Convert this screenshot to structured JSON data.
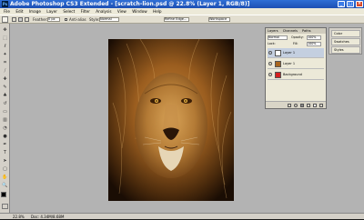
{
  "app": {
    "title": "Adobe Photoshop CS3 Extended - [scratch-lion.psd @ 22.8% (Layer 1, RGB/8)]",
    "icon_label": "Ps"
  },
  "menubar": {
    "items": [
      "File",
      "Edit",
      "Image",
      "Layer",
      "Select",
      "Filter",
      "Analysis",
      "View",
      "Window",
      "Help"
    ]
  },
  "options": {
    "feather_label": "Feather:",
    "feather_value": "0 px",
    "antialias_label": "Anti-alias",
    "style_label": "Style:",
    "style_value": "Normal",
    "refine_label": "Refine Edge...",
    "workspace_label": "Workspace"
  },
  "status": {
    "zoom": "22.8%",
    "doc_info": "Doc: 4.34M/8.68M"
  },
  "layers_panel": {
    "tabs": [
      "Layers",
      "Channels",
      "Paths"
    ],
    "blend_mode": "Normal",
    "opacity_label": "Opacity:",
    "opacity_value": "100%",
    "lock_label": "Lock:",
    "fill_label": "Fill:",
    "fill_value": "100%",
    "layers": [
      {
        "name": "Layer 1",
        "selected": true
      },
      {
        "name": "Layer 1",
        "selected": false
      },
      {
        "name": "Background",
        "selected": false
      }
    ]
  },
  "mini_panels": {
    "items": [
      "Color",
      "Swatches",
      "Styles"
    ]
  },
  "colors": {
    "accent": "#2f6fd6",
    "panel": "#ece9d8",
    "workspace": "#b3b3b3"
  }
}
